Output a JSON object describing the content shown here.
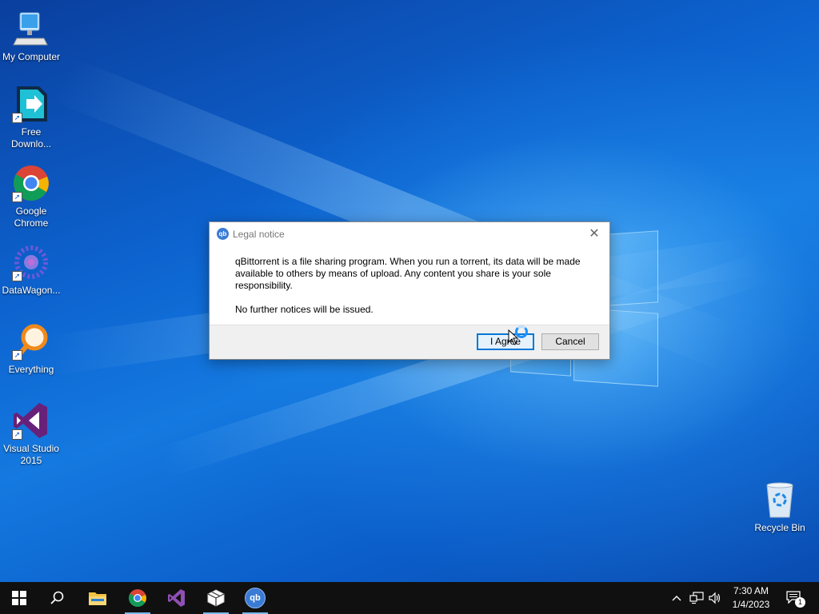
{
  "desktop": {
    "icons": [
      {
        "label": "My Computer"
      },
      {
        "label": "Free Downlo..."
      },
      {
        "label": "Google Chrome"
      },
      {
        "label": "DataWagon..."
      },
      {
        "label": "Everything"
      },
      {
        "label": "Visual Studio 2015"
      },
      {
        "label": "Recycle Bin"
      }
    ]
  },
  "dialog": {
    "title": "Legal notice",
    "app_icon_text": "qb",
    "close_glyph": "✕",
    "message": "qBittorrent is a file sharing program. When you run a torrent, its data will be made available to others by means of upload. Any content you share is your sole responsibility.",
    "notice": "No further notices will be issued.",
    "agree_label": "I Agree",
    "cancel_label": "Cancel"
  },
  "taskbar": {
    "items": [
      {
        "name": "start",
        "icon": "windows-logo-icon"
      },
      {
        "name": "search",
        "icon": "search-icon"
      },
      {
        "name": "file-explorer",
        "icon": "folder-icon"
      },
      {
        "name": "chrome",
        "icon": "chrome-icon"
      },
      {
        "name": "visual-studio",
        "icon": "visual-studio-icon"
      },
      {
        "name": "package",
        "icon": "package-icon"
      },
      {
        "name": "qbittorrent",
        "icon": "qbittorrent-icon",
        "text": "qb"
      }
    ],
    "tray": {
      "time": "7:30 AM",
      "date": "1/4/2023",
      "notification_count": "1"
    }
  },
  "colors": {
    "accent": "#0078d7",
    "taskbar": "#101010"
  }
}
